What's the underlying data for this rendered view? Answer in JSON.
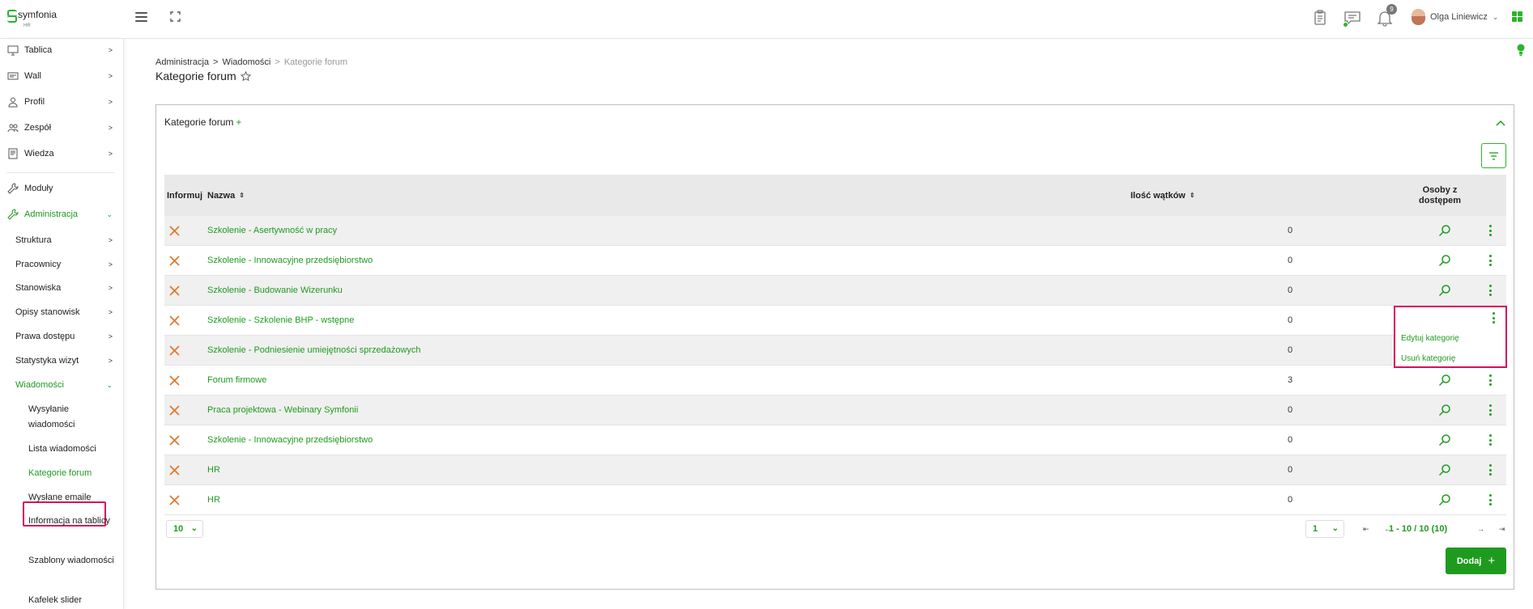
{
  "app": {
    "logo_text": "symfonia",
    "logo_sub": "HR"
  },
  "header": {
    "notification_count": "9",
    "user_name": "Olga Liniewicz"
  },
  "sidebar": {
    "items": [
      {
        "label": "Tablica"
      },
      {
        "label": "Wall"
      },
      {
        "label": "Profil"
      },
      {
        "label": "Zespół"
      },
      {
        "label": "Wiedza"
      },
      {
        "label": "Moduły"
      },
      {
        "label": "Administracja"
      }
    ],
    "admin_items": [
      {
        "label": "Struktura"
      },
      {
        "label": "Pracownicy"
      },
      {
        "label": "Stanowiska"
      },
      {
        "label": "Opisy stanowisk"
      },
      {
        "label": "Prawa dostępu"
      },
      {
        "label": "Statystyka wizyt"
      },
      {
        "label": "Wiadomości"
      }
    ],
    "messages_items": [
      {
        "label": "Wysyłanie wiadomości"
      },
      {
        "label": "Lista wiadomości"
      },
      {
        "label": "Kategorie forum"
      },
      {
        "label": "Wysłane emaile"
      },
      {
        "label": "Informacja na tablicy"
      },
      {
        "label": "Szablony wiadomości"
      },
      {
        "label": "Kafelek slider"
      }
    ]
  },
  "breadcrumb": {
    "items": [
      "Administracja",
      "Wiadomości",
      "Kategorie forum"
    ],
    "separator": ">"
  },
  "page": {
    "title": "Kategorie forum"
  },
  "card": {
    "title": "Kategorie forum",
    "plus": "+"
  },
  "table": {
    "headers": {
      "inform": "Informuj",
      "name": "Nazwa",
      "threads": "Ilość wątków",
      "access_line1": "Osoby z",
      "access_line2": "dostępem"
    },
    "rows": [
      {
        "name": "Szkolenie - Asertywność w pracy",
        "threads": "0"
      },
      {
        "name": "Szkolenie - Innowacyjne przedsiębiorstwo",
        "threads": "0"
      },
      {
        "name": "Szkolenie - Budowanie Wizerunku",
        "threads": "0"
      },
      {
        "name": "Szkolenie - Szkolenie BHP - wstępne",
        "threads": "0"
      },
      {
        "name": "Szkolenie - Podniesienie umiejętności sprzedażowych",
        "threads": "0"
      },
      {
        "name": "Forum firmowe",
        "threads": "3"
      },
      {
        "name": "Praca projektowa - Webinary Symfonii",
        "threads": "0"
      },
      {
        "name": "Szkolenie - Innowacyjne przedsiębiorstwo",
        "threads": "0"
      },
      {
        "name": "HR",
        "threads": "0"
      },
      {
        "name": "HR",
        "threads": "0"
      }
    ]
  },
  "context_menu": {
    "edit": "Edytuj kategorię",
    "delete": "Usuń kategorię"
  },
  "pagination": {
    "per_page": "10",
    "page": "1",
    "info": "1 - 10 / 10 (10)"
  },
  "actions": {
    "add_label": "Dodaj",
    "add_icon": "+"
  },
  "colors": {
    "accent": "#1e9b1e",
    "highlight": "#d6105a",
    "x_icon": "#e8772a"
  }
}
